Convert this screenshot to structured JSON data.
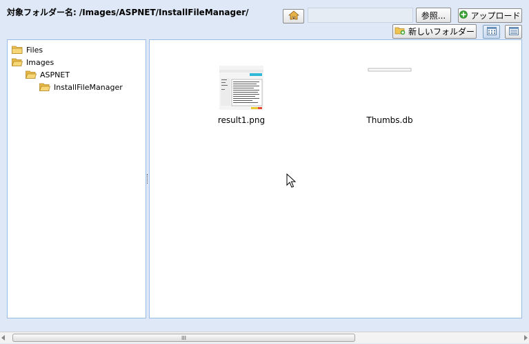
{
  "header": {
    "label": "対象フォルダー名:",
    "path": "/Images/ASPNET/InstallFileManager/"
  },
  "toolbar": {
    "home_icon": "home-icon",
    "file_input_value": "",
    "browse_label": "参照...",
    "upload_label": "アップロード",
    "new_folder_label": "新しいフォルダー",
    "view_thumbnails_icon": "thumbnail-view-icon",
    "view_list_icon": "list-view-icon"
  },
  "tree": {
    "nodes": [
      {
        "label": "Files",
        "level": 0,
        "open": false
      },
      {
        "label": "Images",
        "level": 0,
        "open": true
      },
      {
        "label": "ASPNET",
        "level": 1,
        "open": true
      },
      {
        "label": "InstallFileManager",
        "level": 2,
        "open": true
      }
    ]
  },
  "files": [
    {
      "name": "result1.png",
      "type": "image"
    },
    {
      "name": "Thumbs.db",
      "type": "db"
    }
  ],
  "scrollbar": {
    "grip": "III"
  },
  "colors": {
    "background": "#dfe8f6",
    "panel_border": "#99bbe8",
    "folder": "#f0c453",
    "upload_green": "#3aa335"
  }
}
